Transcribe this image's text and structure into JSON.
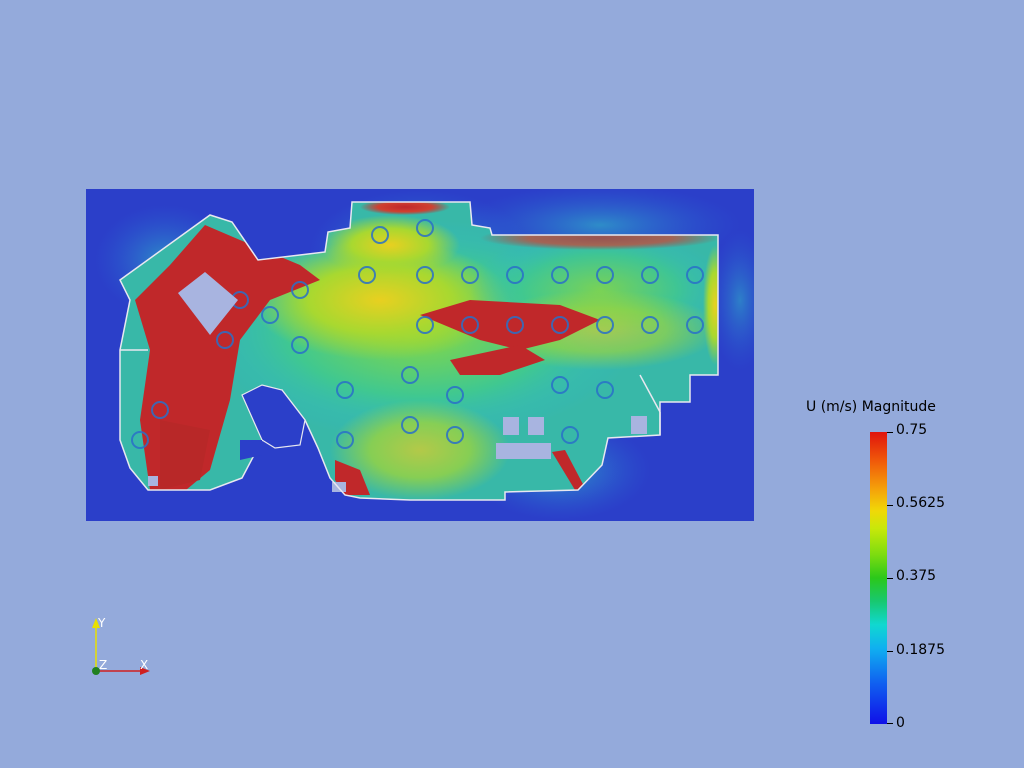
{
  "legend": {
    "title": "U (m/s) Magnitude",
    "ticks": [
      "0.75",
      "0.5625",
      "0.375",
      "0.1875",
      "0"
    ]
  },
  "axes": {
    "x": "X",
    "y": "Y",
    "z": "Z"
  },
  "colors": {
    "background": "#94aadb",
    "field_low": "#2b3fc9",
    "field_high": "#c0282a",
    "walls": "#e8e8f0"
  }
}
